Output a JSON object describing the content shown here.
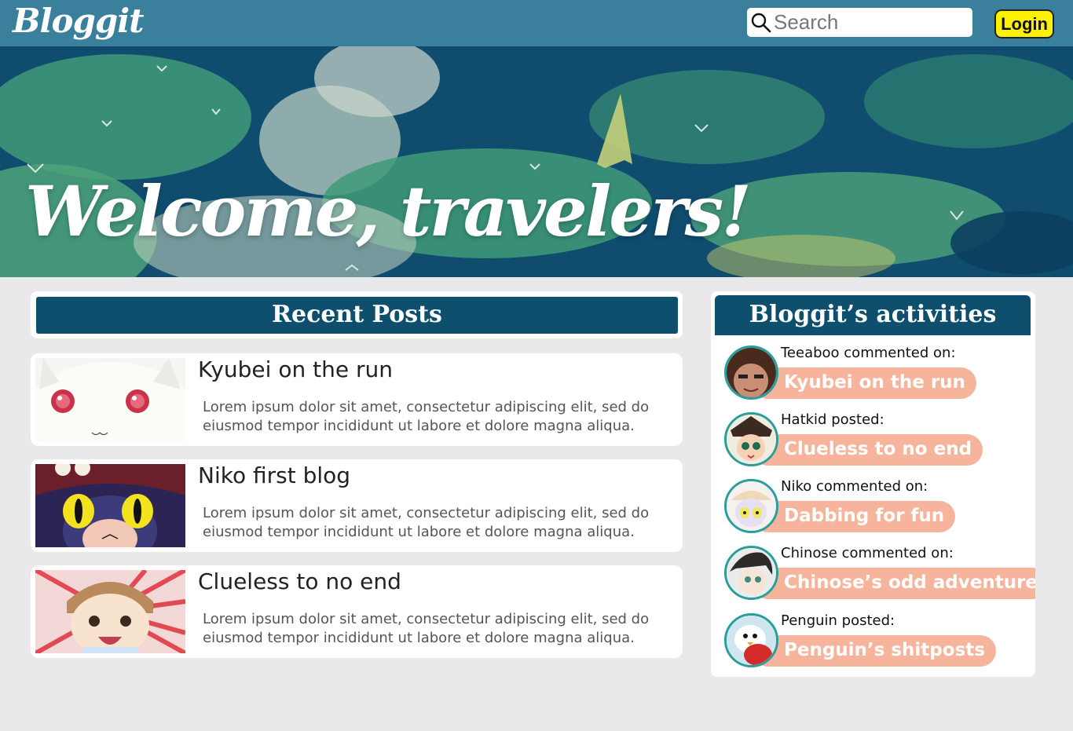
{
  "header": {
    "logo_text": "Bloggit",
    "search_placeholder": "Search",
    "login_label": "Login"
  },
  "hero": {
    "title": "Welcome, travelers!"
  },
  "recent_posts": {
    "heading": "Recent Posts",
    "posts": [
      {
        "title": "Kyubei on the run",
        "excerpt": "Lorem ipsum dolor sit amet, consectetur adipiscing elit, sed do eiusmod tempor incididunt ut labore et dolore magna aliqua."
      },
      {
        "title": "Niko first blog",
        "excerpt": "Lorem ipsum dolor sit amet, consectetur adipiscing elit, sed do eiusmod tempor incididunt ut labore et dolore magna aliqua."
      },
      {
        "title": "Clueless to no end",
        "excerpt": "Lorem ipsum dolor sit amet, consectetur adipiscing elit, sed do eiusmod tempor incididunt ut labore et dolore magna aliqua."
      }
    ]
  },
  "activities": {
    "heading": "Bloggit’s activities",
    "items": [
      {
        "text": "Teeaboo commented on:",
        "link": "Kyubei on the run"
      },
      {
        "text": "Hatkid posted:",
        "link": "Clueless to no end"
      },
      {
        "text": "Niko commented on:",
        "link": "Dabbing for fun"
      },
      {
        "text": "Chinose commented on:",
        "link": "Chinose’s odd adventure"
      },
      {
        "text": "Penguin posted:",
        "link": "Penguin’s shitposts"
      }
    ]
  },
  "colors": {
    "topbar": "#3a7f9c",
    "header_bar": "#0e4f6e",
    "login_bg": "#fff200",
    "pill_bg": "#f7b49d",
    "avatar_ring": "#2a9e9a",
    "page_bg": "#e9e8eb"
  }
}
